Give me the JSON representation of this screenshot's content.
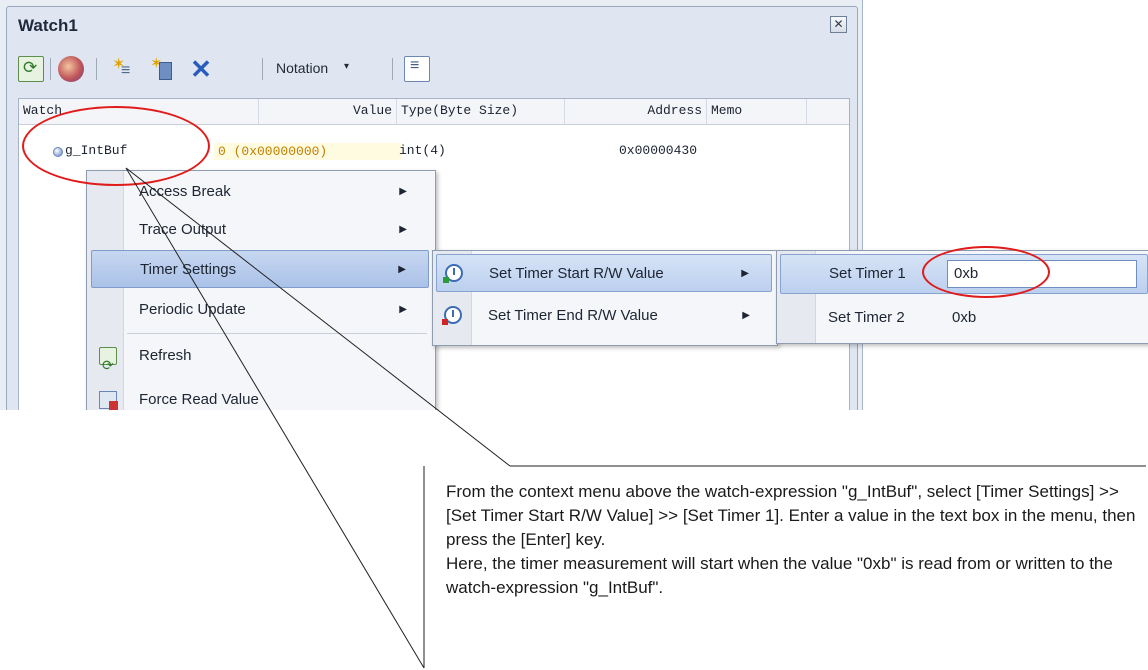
{
  "window": {
    "title": "Watch1",
    "close_icon": "close-icon"
  },
  "toolbar": {
    "notation_label": "Notation",
    "notation_arrow": "▾"
  },
  "grid": {
    "columns": [
      "Watch",
      "Value",
      "Type(Byte Size)",
      "Address",
      "Memo"
    ],
    "rows": [
      {
        "name": "g_IntBuf",
        "value": "0 (0x00000000)",
        "type": "int(4)",
        "address": "0x00000430",
        "memo": ""
      }
    ]
  },
  "context_menu": {
    "items": [
      {
        "label": "Access Break",
        "has_submenu": true
      },
      {
        "label": "Trace Output",
        "has_submenu": true
      },
      {
        "label": "Timer Settings",
        "has_submenu": true,
        "highlighted": true
      },
      {
        "label": "Periodic Update",
        "has_submenu": true
      },
      {
        "label": "Refresh",
        "icon": "refresh-icon"
      },
      {
        "label": "Force Read Value",
        "icon": "force-read-icon"
      }
    ],
    "arrow": "▶"
  },
  "timer_submenu": {
    "items": [
      {
        "label": "Set Timer Start R/W Value",
        "icon": "timer-start-icon",
        "highlighted": true
      },
      {
        "label": "Set Timer End R/W Value",
        "icon": "timer-end-icon"
      }
    ]
  },
  "timer_value_submenu": {
    "items": [
      {
        "label": "Set Timer 1",
        "value": "0xb",
        "editable": true
      },
      {
        "label": "Set Timer 2",
        "value": "0xb"
      }
    ]
  },
  "callout": {
    "paragraph1": "From the context menu above the watch-expression \"g_IntBuf\", select [Timer Settings] >> [Set Timer Start R/W Value] >> [Set Timer 1]. Enter a value in the text box in the menu, then press the [Enter] key.",
    "paragraph2": "Here, the timer measurement will start when the value \"0xb\" is read from or written to the watch-expression \"g_IntBuf\"."
  },
  "colors": {
    "highlight_ellipse": "#e01b1b",
    "menu_highlight": "#aac2e8"
  }
}
